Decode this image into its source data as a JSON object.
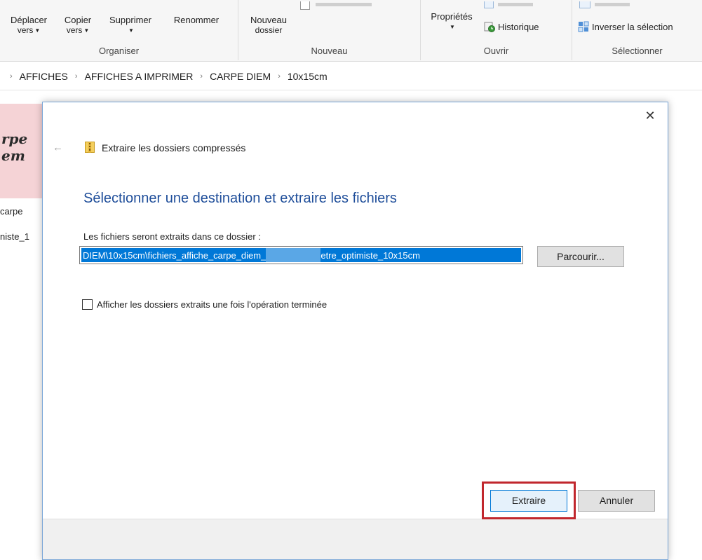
{
  "ribbon": {
    "organiser": {
      "label": "Organiser",
      "move_line1": "Déplacer",
      "move_line2": "vers",
      "copy_line1": "Copier",
      "copy_line2": "vers",
      "delete": "Supprimer",
      "rename": "Renommer"
    },
    "nouveau": {
      "label": "Nouveau",
      "new_folder_line1": "Nouveau",
      "new_folder_line2": "dossier"
    },
    "ouvrir": {
      "label": "Ouvrir",
      "properties": "Propriétés",
      "history": "Historique"
    },
    "selectionner": {
      "label": "Sélectionner",
      "invert": "Inverser la sélection"
    }
  },
  "breadcrumb": [
    "AFFICHES",
    "AFFICHES A IMPRIMER",
    "CARPE DIEM",
    "10x15cm"
  ],
  "behind": {
    "thumb_text_line1": "rpe",
    "thumb_text_line2": "em",
    "file_line1": "carpe",
    "file_line2": "niste_1"
  },
  "dialog": {
    "header": "Extraire les dossiers compressés",
    "title": "Sélectionner une destination et extraire les fichiers",
    "field_label": "Les fichiers seront extraits dans ce dossier :",
    "path_part1": "DIEM\\10x15cm\\fichiers_affiche_carpe_diem_",
    "path_part2": "etre_optimiste_10x15cm",
    "browse_label": "Parcourir...",
    "checkbox_label": "Afficher les dossiers extraits une fois l'opération terminée",
    "extract_label": "Extraire",
    "cancel_label": "Annuler"
  },
  "colors": {
    "accent_title": "#1f4e9a",
    "selection": "#0078d7",
    "highlight_box": "#c1272d"
  }
}
